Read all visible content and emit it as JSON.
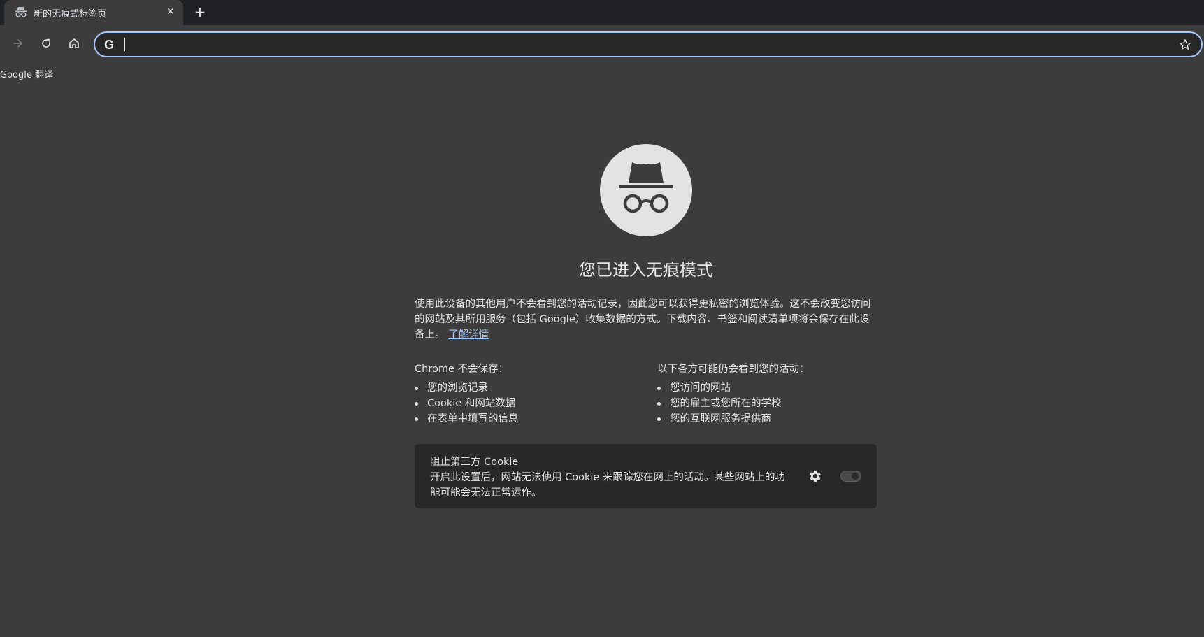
{
  "tab": {
    "title": "新的无痕式标签页",
    "icon": "incognito-icon",
    "close_label": "✕"
  },
  "new_tab_label": "+",
  "toolbar": {
    "forward_icon": "arrow-right-icon",
    "reload_icon": "reload-icon",
    "home_icon": "home-icon"
  },
  "omnibox": {
    "value": "",
    "placeholder": "",
    "search_engine_icon": "google-g-icon",
    "search_engine_glyph": "G",
    "star_icon": "star-icon"
  },
  "bookmarks": [
    {
      "label": "Google 翻译"
    }
  ],
  "main": {
    "title": "您已进入无痕模式",
    "intro": "使用此设备的其他用户不会看到您的活动记录，因此您可以获得更私密的浏览体验。这不会改变您访问的网站及其所用服务（包括 Google）收集数据的方式。下载内容、书签和阅读清单项将会保存在此设备上。",
    "learn_more": "了解详情",
    "not_saved": {
      "title": "Chrome 不会保存：",
      "items": [
        "您的浏览记录",
        "Cookie 和网站数据",
        "在表单中填写的信息"
      ]
    },
    "may_see": {
      "title": "以下各方可能仍会看到您的活动：",
      "items": [
        "您访问的网站",
        "您的雇主或您所在的学校",
        "您的互联网服务提供商"
      ]
    },
    "cookie_card": {
      "title": "阻止第三方 Cookie",
      "description": "开启此设置后，网站无法使用 Cookie 来跟踪您在网上的活动。某些网站上的功能可能会无法正常运作。",
      "toggle_on": false
    }
  },
  "colors": {
    "background": "#3c3c3c",
    "tabstrip": "#202124",
    "link": "#a8c7fa",
    "card": "#282828"
  }
}
